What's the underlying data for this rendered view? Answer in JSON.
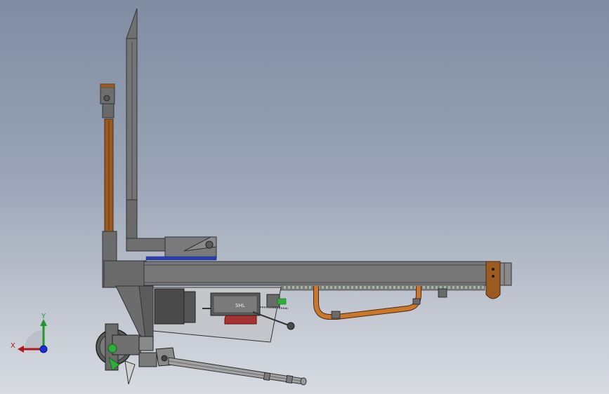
{
  "scene": {
    "type": "cad-model-side-view",
    "background_top": "#7f8ca2",
    "background_bottom": "#d8dbe2"
  },
  "triad": {
    "x_label": "X",
    "y_label": "Y",
    "x_color": "#b01818",
    "y_color": "#1f9a2a",
    "z_color": "#1a2fd6"
  },
  "colors": {
    "frame": "#6e6e6e",
    "frame_dark": "#3a3a3a",
    "wood": "#9a5a22",
    "hose": "#c9782b",
    "blue_strip": "#2a3fae",
    "wheel_red": "#a83232",
    "green_part": "#2fae3a"
  }
}
